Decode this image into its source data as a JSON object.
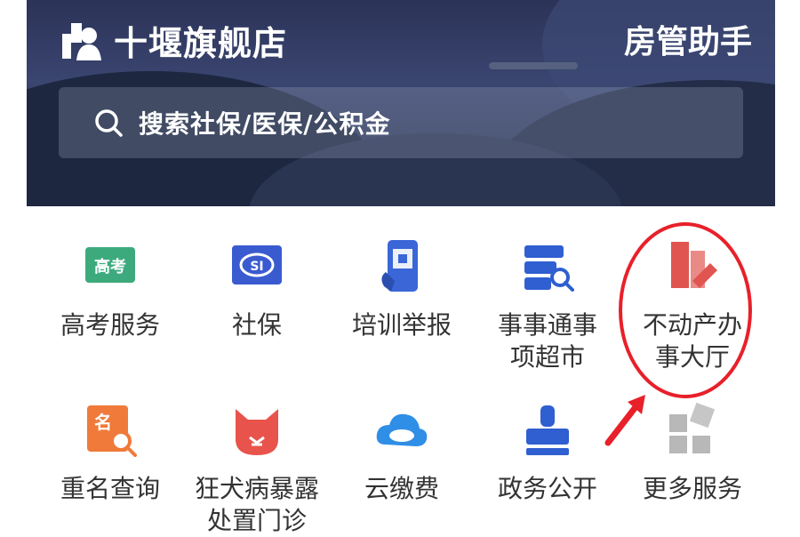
{
  "header": {
    "app_name": "十堰旗舰店",
    "helper_title": "房管助手"
  },
  "search": {
    "placeholder": "搜索社保/医保/公积金"
  },
  "services": [
    {
      "label": "高考服务",
      "icon": "gaokao-icon",
      "icon_text": "高考",
      "color": "#3daa7e"
    },
    {
      "label": "社保",
      "icon": "social-security-icon",
      "color": "#3a5bd0"
    },
    {
      "label": "培训举报",
      "icon": "phone-scan-icon",
      "color": "#3a66d8"
    },
    {
      "label": "事事通事项超市",
      "icon": "tickets-search-icon",
      "color": "#2f5fd0"
    },
    {
      "label": "不动产办事大厅",
      "icon": "real-estate-icon",
      "color": "#e05550"
    },
    {
      "label": "重名查询",
      "icon": "name-search-icon",
      "icon_text": "名",
      "color": "#f07a3a"
    },
    {
      "label": "狂犬病暴露处置门诊",
      "icon": "cat-face-icon",
      "color": "#e8534c"
    },
    {
      "label": "云缴费",
      "icon": "cloud-icon",
      "color": "#2f8ee6"
    },
    {
      "label": "政务公开",
      "icon": "stamp-icon",
      "color": "#2f5fd0"
    },
    {
      "label": "更多服务",
      "icon": "grid-more-icon",
      "color": "#b8b8b8"
    }
  ],
  "highlight_color": "#e8202a"
}
